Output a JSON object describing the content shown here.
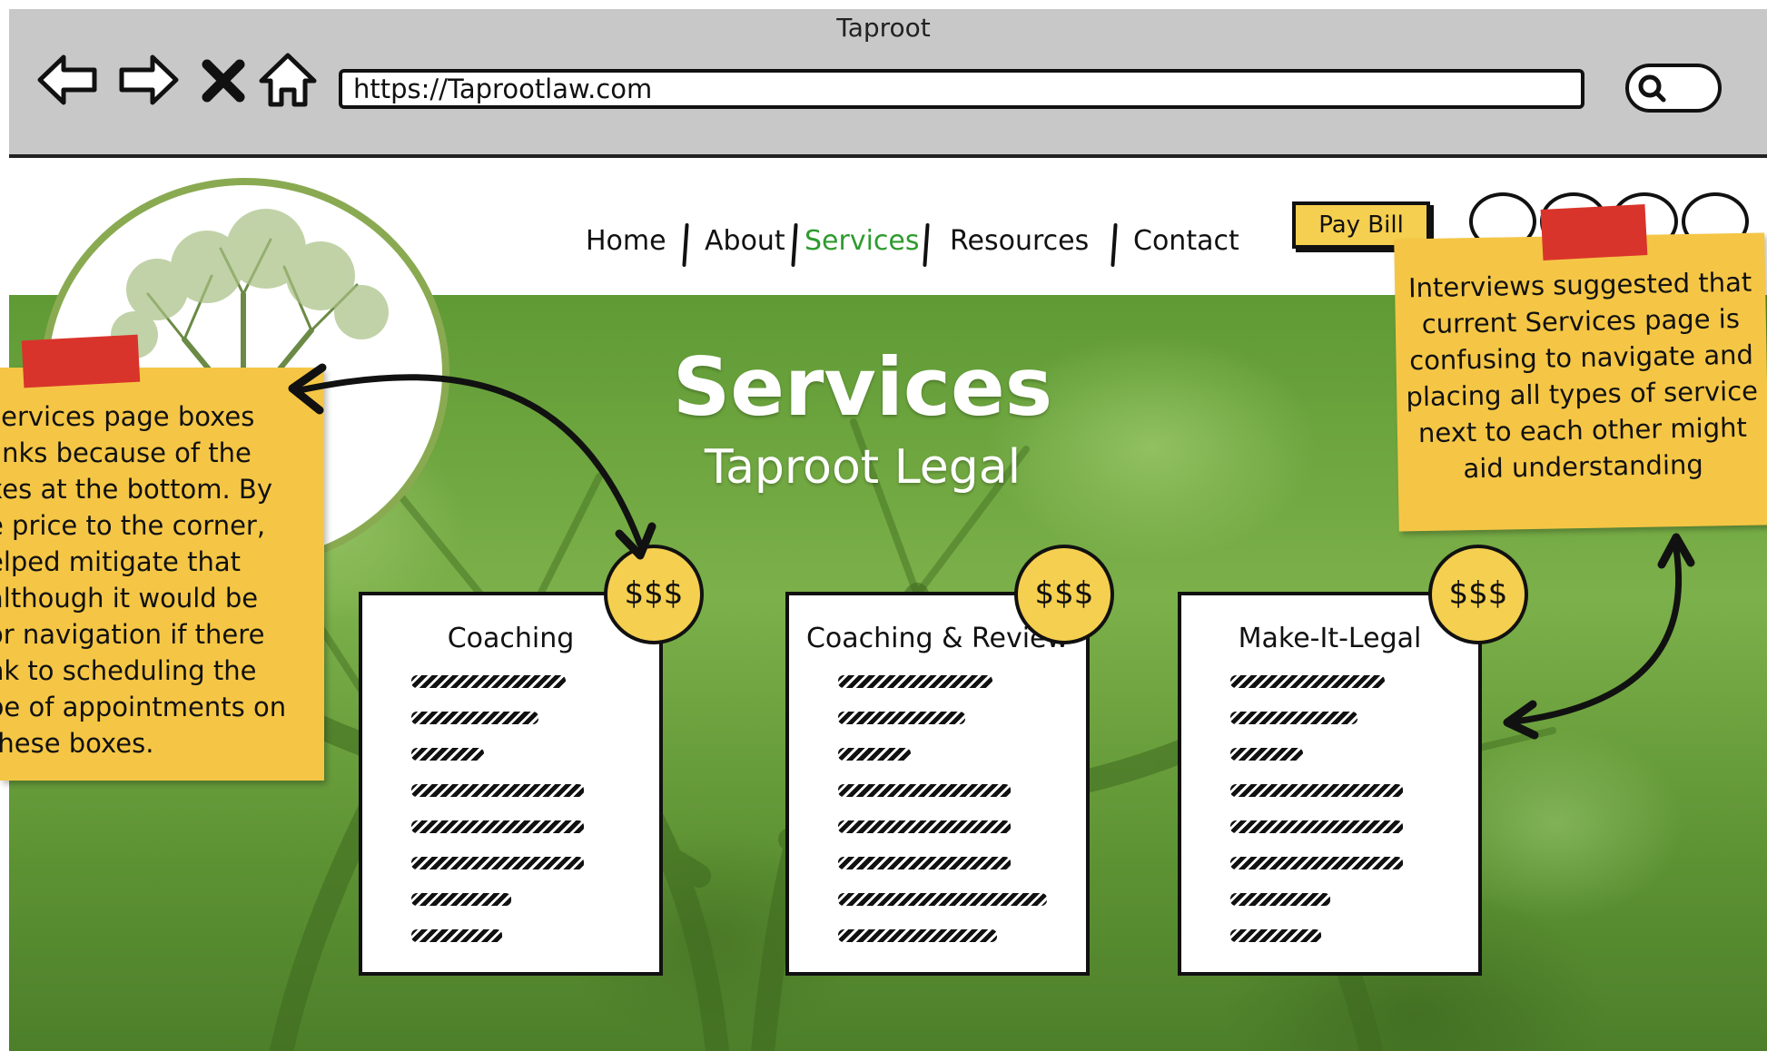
{
  "window": {
    "title": "Taproot"
  },
  "toolbar": {
    "url": "https://Taprootlaw.com",
    "icons": [
      "back-arrow-icon",
      "forward-arrow-icon",
      "close-icon",
      "home-icon",
      "search-icon"
    ]
  },
  "nav": {
    "items": [
      {
        "label": "Home"
      },
      {
        "label": "About"
      },
      {
        "label": "Services",
        "active": true
      },
      {
        "label": "Resources"
      },
      {
        "label": "Contact"
      }
    ],
    "pay_bill": "Pay Bill",
    "active_color": "#2e9b2e"
  },
  "hero": {
    "title": "Services",
    "subtitle": "Taproot Legal"
  },
  "cards": [
    {
      "title": "Coaching",
      "price": "$$$"
    },
    {
      "title": "Coaching & Review",
      "price": "$$$"
    },
    {
      "title": "Make-It-Legal",
      "price": "$$$"
    }
  ],
  "notes": {
    "left": "services page boxes\nlinks because of the\nxes at the bottom. By\ne price to the corner,\nelped mitigate that\nalthough it would be\nor navigation if there\nnk to scheduling the\npe of appointments on\nthese boxes.",
    "right": "Interviews suggested that current Services page is confusing to navigate and placing all types of service next to each other might aid understanding"
  },
  "colors": {
    "accent_yellow": "#f5cf4f",
    "tape_red": "#d9342b",
    "hero_green": "#6fa640"
  }
}
